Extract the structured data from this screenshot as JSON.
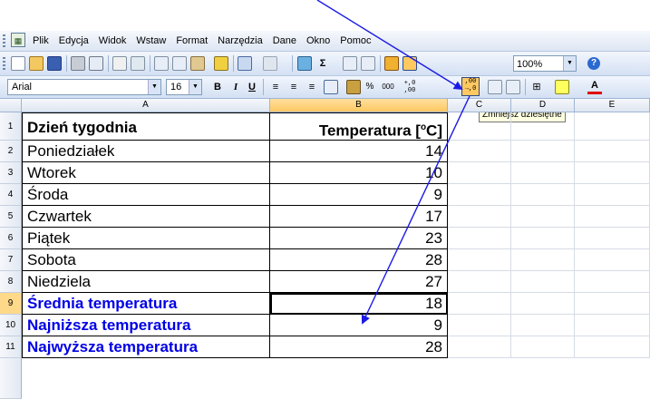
{
  "menubar": {
    "items": [
      "Plik",
      "Edycja",
      "Widok",
      "Wstaw",
      "Format",
      "Narzędzia",
      "Dane",
      "Okno",
      "Pomoc"
    ]
  },
  "toolbar": {
    "zoom": "100%",
    "help": "?"
  },
  "formatting": {
    "font": "Arial",
    "size": "16",
    "bold": "B",
    "italic": "I",
    "underline": "U",
    "percent": "%",
    "thousands": "000",
    "font_color": "A",
    "tooltip": "Zmniejsz dziesiętne"
  },
  "columns": [
    "A",
    "B",
    "C",
    "D",
    "E"
  ],
  "rows": [
    {
      "num": "1",
      "a": "Dzień tygodnia",
      "b": "Temperatura [°C]",
      "style": "header"
    },
    {
      "num": "2",
      "a": "Poniedziałek",
      "b": "14",
      "style": "normal"
    },
    {
      "num": "3",
      "a": "Wtorek",
      "b": "10",
      "style": "normal"
    },
    {
      "num": "4",
      "a": "Środa",
      "b": "9",
      "style": "normal"
    },
    {
      "num": "5",
      "a": "Czwartek",
      "b": "17",
      "style": "normal"
    },
    {
      "num": "6",
      "a": "Piątek",
      "b": "23",
      "style": "normal"
    },
    {
      "num": "7",
      "a": "Sobota",
      "b": "28",
      "style": "normal"
    },
    {
      "num": "8",
      "a": "Niedziela",
      "b": "27",
      "style": "normal"
    },
    {
      "num": "9",
      "a": "Średnia temperatura",
      "b": "18",
      "style": "summary"
    },
    {
      "num": "10",
      "a": "Najniższa temperatura",
      "b": "9",
      "style": "summary"
    },
    {
      "num": "11",
      "a": "Najwyższa temperatura",
      "b": "28",
      "style": "summary"
    }
  ],
  "colors": {
    "summary_text": "#0000e6",
    "arrow": "#1a1ae6",
    "selection": "#ffc860"
  }
}
